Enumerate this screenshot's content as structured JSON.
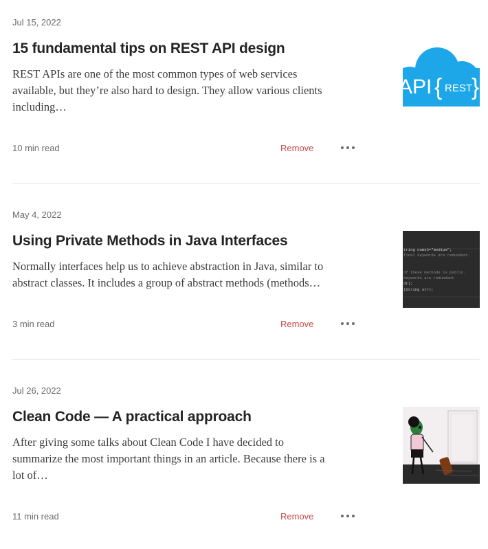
{
  "articles": [
    {
      "date": "Jul 15, 2022",
      "title": "15 fundamental tips on REST API design",
      "excerpt_lines": [
        "REST APIs are one of the most common types of web services",
        "available, but they’re also hard to design. They allow various clients",
        "including…"
      ],
      "read_time": "10 min read",
      "remove_label": "Remove",
      "thumb": {
        "left_text": "API",
        "brace_open": "{",
        "inner_text": "REST",
        "brace_close": "}",
        "color": "#1ea7e8"
      }
    },
    {
      "date": "May 4, 2022",
      "title": "Using Private Methods in Java Interfaces",
      "excerpt_lines": [
        "Normally interfaces help us to achieve abstraction in Java, similar to",
        "abstract classes. It includes a group of abstract methods (methods…"
      ],
      "read_time": "3 min read",
      "remove_label": "Remove",
      "thumb": {
        "code_lines": [
          "tring name3=\"medium\";",
          "final keywords are redundant.",
          "of these methods  is public.",
          "keywords are redundant",
          "d();",
          "(String str);"
        ],
        "color": "#2b2b2b"
      }
    },
    {
      "date": "Jul 26, 2022",
      "title": "Clean Code — A practical approach",
      "excerpt_lines": [
        "After giving some talks about Clean Code I have decided to",
        "summarize the most important things in an article. Because there is a",
        "lot of…"
      ],
      "read_time": "11 min read",
      "remove_label": "Remove",
      "thumb": {
        "color": "#f3eef0"
      }
    }
  ]
}
